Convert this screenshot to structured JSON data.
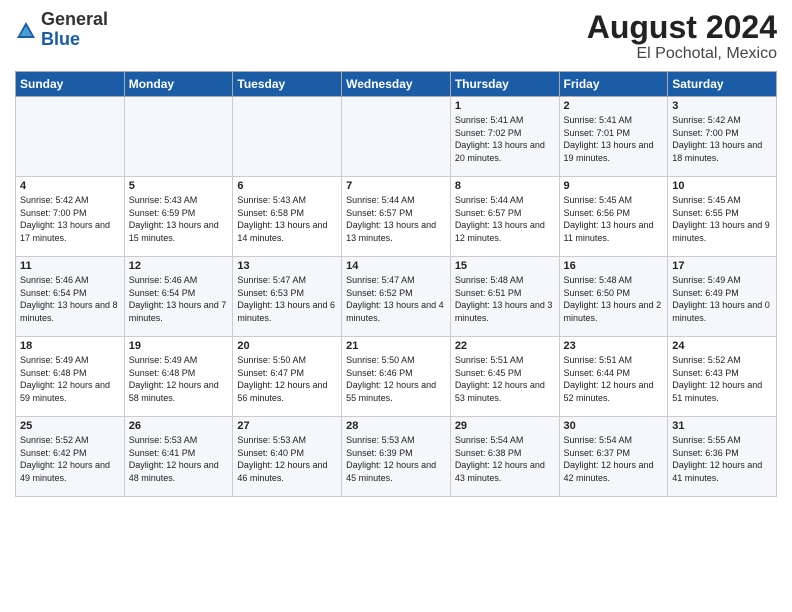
{
  "header": {
    "logo": {
      "general": "General",
      "blue": "Blue"
    },
    "title": "August 2024",
    "subtitle": "El Pochotal, Mexico"
  },
  "weekdays": [
    "Sunday",
    "Monday",
    "Tuesday",
    "Wednesday",
    "Thursday",
    "Friday",
    "Saturday"
  ],
  "weeks": [
    [
      {
        "day": "",
        "sunrise": "",
        "sunset": "",
        "daylight": ""
      },
      {
        "day": "",
        "sunrise": "",
        "sunset": "",
        "daylight": ""
      },
      {
        "day": "",
        "sunrise": "",
        "sunset": "",
        "daylight": ""
      },
      {
        "day": "",
        "sunrise": "",
        "sunset": "",
        "daylight": ""
      },
      {
        "day": "1",
        "sunrise": "Sunrise: 5:41 AM",
        "sunset": "Sunset: 7:02 PM",
        "daylight": "Daylight: 13 hours and 20 minutes."
      },
      {
        "day": "2",
        "sunrise": "Sunrise: 5:41 AM",
        "sunset": "Sunset: 7:01 PM",
        "daylight": "Daylight: 13 hours and 19 minutes."
      },
      {
        "day": "3",
        "sunrise": "Sunrise: 5:42 AM",
        "sunset": "Sunset: 7:00 PM",
        "daylight": "Daylight: 13 hours and 18 minutes."
      }
    ],
    [
      {
        "day": "4",
        "sunrise": "Sunrise: 5:42 AM",
        "sunset": "Sunset: 7:00 PM",
        "daylight": "Daylight: 13 hours and 17 minutes."
      },
      {
        "day": "5",
        "sunrise": "Sunrise: 5:43 AM",
        "sunset": "Sunset: 6:59 PM",
        "daylight": "Daylight: 13 hours and 15 minutes."
      },
      {
        "day": "6",
        "sunrise": "Sunrise: 5:43 AM",
        "sunset": "Sunset: 6:58 PM",
        "daylight": "Daylight: 13 hours and 14 minutes."
      },
      {
        "day": "7",
        "sunrise": "Sunrise: 5:44 AM",
        "sunset": "Sunset: 6:57 PM",
        "daylight": "Daylight: 13 hours and 13 minutes."
      },
      {
        "day": "8",
        "sunrise": "Sunrise: 5:44 AM",
        "sunset": "Sunset: 6:57 PM",
        "daylight": "Daylight: 13 hours and 12 minutes."
      },
      {
        "day": "9",
        "sunrise": "Sunrise: 5:45 AM",
        "sunset": "Sunset: 6:56 PM",
        "daylight": "Daylight: 13 hours and 11 minutes."
      },
      {
        "day": "10",
        "sunrise": "Sunrise: 5:45 AM",
        "sunset": "Sunset: 6:55 PM",
        "daylight": "Daylight: 13 hours and 9 minutes."
      }
    ],
    [
      {
        "day": "11",
        "sunrise": "Sunrise: 5:46 AM",
        "sunset": "Sunset: 6:54 PM",
        "daylight": "Daylight: 13 hours and 8 minutes."
      },
      {
        "day": "12",
        "sunrise": "Sunrise: 5:46 AM",
        "sunset": "Sunset: 6:54 PM",
        "daylight": "Daylight: 13 hours and 7 minutes."
      },
      {
        "day": "13",
        "sunrise": "Sunrise: 5:47 AM",
        "sunset": "Sunset: 6:53 PM",
        "daylight": "Daylight: 13 hours and 6 minutes."
      },
      {
        "day": "14",
        "sunrise": "Sunrise: 5:47 AM",
        "sunset": "Sunset: 6:52 PM",
        "daylight": "Daylight: 13 hours and 4 minutes."
      },
      {
        "day": "15",
        "sunrise": "Sunrise: 5:48 AM",
        "sunset": "Sunset: 6:51 PM",
        "daylight": "Daylight: 13 hours and 3 minutes."
      },
      {
        "day": "16",
        "sunrise": "Sunrise: 5:48 AM",
        "sunset": "Sunset: 6:50 PM",
        "daylight": "Daylight: 13 hours and 2 minutes."
      },
      {
        "day": "17",
        "sunrise": "Sunrise: 5:49 AM",
        "sunset": "Sunset: 6:49 PM",
        "daylight": "Daylight: 13 hours and 0 minutes."
      }
    ],
    [
      {
        "day": "18",
        "sunrise": "Sunrise: 5:49 AM",
        "sunset": "Sunset: 6:48 PM",
        "daylight": "Daylight: 12 hours and 59 minutes."
      },
      {
        "day": "19",
        "sunrise": "Sunrise: 5:49 AM",
        "sunset": "Sunset: 6:48 PM",
        "daylight": "Daylight: 12 hours and 58 minutes."
      },
      {
        "day": "20",
        "sunrise": "Sunrise: 5:50 AM",
        "sunset": "Sunset: 6:47 PM",
        "daylight": "Daylight: 12 hours and 56 minutes."
      },
      {
        "day": "21",
        "sunrise": "Sunrise: 5:50 AM",
        "sunset": "Sunset: 6:46 PM",
        "daylight": "Daylight: 12 hours and 55 minutes."
      },
      {
        "day": "22",
        "sunrise": "Sunrise: 5:51 AM",
        "sunset": "Sunset: 6:45 PM",
        "daylight": "Daylight: 12 hours and 53 minutes."
      },
      {
        "day": "23",
        "sunrise": "Sunrise: 5:51 AM",
        "sunset": "Sunset: 6:44 PM",
        "daylight": "Daylight: 12 hours and 52 minutes."
      },
      {
        "day": "24",
        "sunrise": "Sunrise: 5:52 AM",
        "sunset": "Sunset: 6:43 PM",
        "daylight": "Daylight: 12 hours and 51 minutes."
      }
    ],
    [
      {
        "day": "25",
        "sunrise": "Sunrise: 5:52 AM",
        "sunset": "Sunset: 6:42 PM",
        "daylight": "Daylight: 12 hours and 49 minutes."
      },
      {
        "day": "26",
        "sunrise": "Sunrise: 5:53 AM",
        "sunset": "Sunset: 6:41 PM",
        "daylight": "Daylight: 12 hours and 48 minutes."
      },
      {
        "day": "27",
        "sunrise": "Sunrise: 5:53 AM",
        "sunset": "Sunset: 6:40 PM",
        "daylight": "Daylight: 12 hours and 46 minutes."
      },
      {
        "day": "28",
        "sunrise": "Sunrise: 5:53 AM",
        "sunset": "Sunset: 6:39 PM",
        "daylight": "Daylight: 12 hours and 45 minutes."
      },
      {
        "day": "29",
        "sunrise": "Sunrise: 5:54 AM",
        "sunset": "Sunset: 6:38 PM",
        "daylight": "Daylight: 12 hours and 43 minutes."
      },
      {
        "day": "30",
        "sunrise": "Sunrise: 5:54 AM",
        "sunset": "Sunset: 6:37 PM",
        "daylight": "Daylight: 12 hours and 42 minutes."
      },
      {
        "day": "31",
        "sunrise": "Sunrise: 5:55 AM",
        "sunset": "Sunset: 6:36 PM",
        "daylight": "Daylight: 12 hours and 41 minutes."
      }
    ]
  ]
}
